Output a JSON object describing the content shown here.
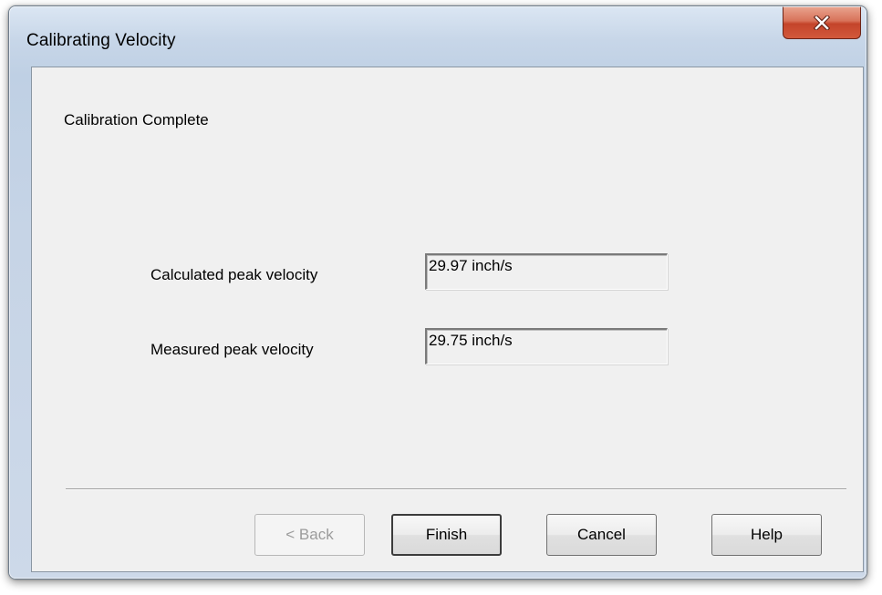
{
  "window": {
    "title": "Calibrating Velocity"
  },
  "page": {
    "heading": "Calibration Complete"
  },
  "fields": [
    {
      "label": "Calculated peak velocity",
      "value": "29.97 inch/s"
    },
    {
      "label": "Measured peak velocity",
      "value": "29.75 inch/s"
    }
  ],
  "buttons": {
    "back": "< Back",
    "finish": "Finish",
    "cancel": "Cancel",
    "help": "Help"
  },
  "icons": {
    "close": "close-icon"
  },
  "colors": {
    "close_button": "#c4442a",
    "dialog_background": "#f0f0f0",
    "frame": "#bfd0e4"
  }
}
